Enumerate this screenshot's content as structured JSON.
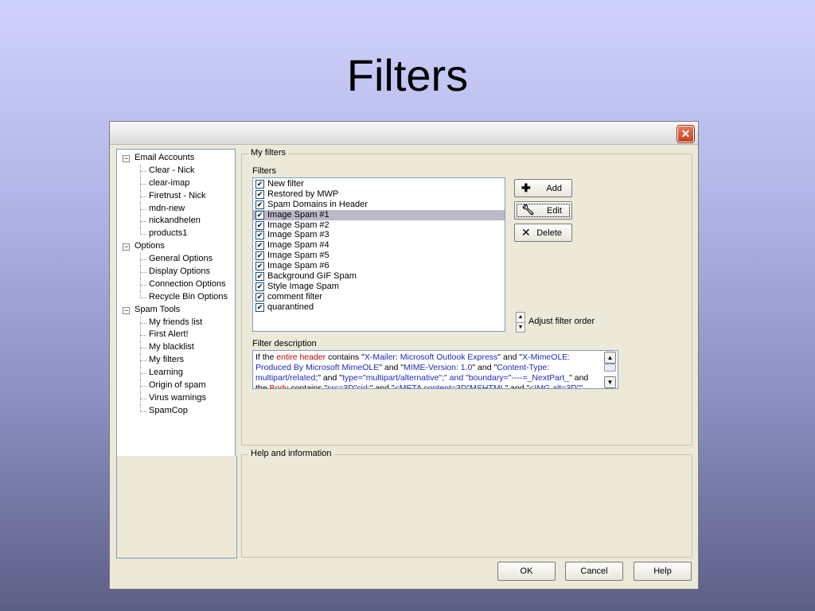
{
  "slide": {
    "title": "Filters"
  },
  "window": {
    "close_glyph": "✕"
  },
  "tree": {
    "groups": [
      {
        "label": "Email Accounts",
        "expander": "−",
        "children": [
          "Clear - Nick",
          "clear-imap",
          "Firetrust - Nick",
          "mdn-new",
          "nickandhelen",
          "products1"
        ]
      },
      {
        "label": "Options",
        "expander": "−",
        "children": [
          "General Options",
          "Display Options",
          "Connection Options",
          "Recycle Bin Options"
        ]
      },
      {
        "label": "Spam Tools",
        "expander": "−",
        "children": [
          "My friends list",
          "First Alert!",
          "My blacklist",
          "My filters",
          "Learning",
          "Origin of spam",
          "Virus warnings",
          "SpamCop"
        ]
      }
    ]
  },
  "my_filters": {
    "group_label": "My filters",
    "filters_label": "Filters",
    "items": [
      {
        "label": "New filter",
        "checked": true
      },
      {
        "label": "Restored by MWP",
        "checked": true
      },
      {
        "label": "Spam Domains in Header",
        "checked": true
      },
      {
        "label": "Image Spam #1",
        "checked": true,
        "selected": true
      },
      {
        "label": "Image Spam #2",
        "checked": true
      },
      {
        "label": "Image Spam #3",
        "checked": true
      },
      {
        "label": "Image Spam #4",
        "checked": true
      },
      {
        "label": "Image Spam #5",
        "checked": true
      },
      {
        "label": "Image Spam #6",
        "checked": true
      },
      {
        "label": "Background GIF Spam",
        "checked": true
      },
      {
        "label": "Style Image Spam",
        "checked": true
      },
      {
        "label": "comment filter",
        "checked": true
      },
      {
        "label": "quarantined",
        "checked": true
      }
    ],
    "add_label": "Add",
    "edit_label": "Edit",
    "delete_label": "Delete",
    "adjust_order_label": "Adjust filter order",
    "description_label": "Filter description",
    "description_segments": [
      {
        "t": "If the ",
        "c": ""
      },
      {
        "t": "entire header",
        "c": "red"
      },
      {
        "t": " contains \"",
        "c": ""
      },
      {
        "t": "X-Mailer: Microsoft Outlook Express",
        "c": "blue"
      },
      {
        "t": "\" and \"",
        "c": ""
      },
      {
        "t": "X-MimeOLE: Produced By Microsoft MimeOLE",
        "c": "blue"
      },
      {
        "t": "\" and \"",
        "c": ""
      },
      {
        "t": "MIME-Version: 1.0",
        "c": "blue"
      },
      {
        "t": "\" and \"",
        "c": ""
      },
      {
        "t": "Content-Type: multipart/related;",
        "c": "blue"
      },
      {
        "t": "\" and \"",
        "c": ""
      },
      {
        "t": "type=\"multipart/alternative\";",
        "c": "blue"
      },
      {
        "t": "\" and \"boundary=\"----=_NextPart_",
        "c": "blue"
      },
      {
        "t": "\" and the ",
        "c": ""
      },
      {
        "t": "Body",
        "c": "red"
      },
      {
        "t": " contains \"",
        "c": ""
      },
      {
        "t": "src=3D\"cid:",
        "c": "blue"
      },
      {
        "t": "\" and \"",
        "c": ""
      },
      {
        "t": "<META content=3D\"MSHTML",
        "c": "blue"
      },
      {
        "t": "\" and \"",
        "c": ""
      },
      {
        "t": "<IMG alt=3D\"\"",
        "c": "blue"
      }
    ]
  },
  "help": {
    "group_label": "Help and information"
  },
  "footer": {
    "ok_label": "OK",
    "cancel_label": "Cancel",
    "help_label": "Help"
  }
}
